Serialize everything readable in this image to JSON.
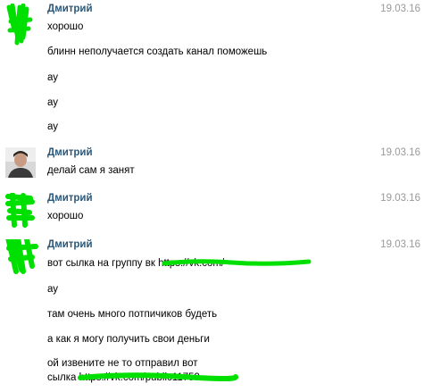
{
  "colors": {
    "author": "#2b587a",
    "date": "#999999",
    "scribble": "#00e000",
    "background": "#ffffff"
  },
  "groups": [
    {
      "author": "Дмитрий",
      "date": "19.03.16",
      "avatar": "redacted-green",
      "messages": [
        "хорошо",
        "блинн неполучается создать канал поможешь",
        "ау",
        "ау",
        "ау"
      ]
    },
    {
      "author": "Дмитрий",
      "date": "19.03.16",
      "avatar": "photo",
      "messages": [
        "делай сам я занят"
      ]
    },
    {
      "author": "Дмитрий",
      "date": "19.03.16",
      "avatar": "redacted-green",
      "messages": [
        "хорошо"
      ]
    },
    {
      "author": "Дмитрий",
      "date": "19.03.16",
      "avatar": "redacted-green",
      "messages": [
        "вот сылка на группу вк https://vk.com/",
        "ау",
        "там очень много потпичиков будеть",
        "а как я могу получить свои деньги",
        "ой извените не то отправил вот",
        "сылка https://vk.com/public11759"
      ]
    }
  ]
}
